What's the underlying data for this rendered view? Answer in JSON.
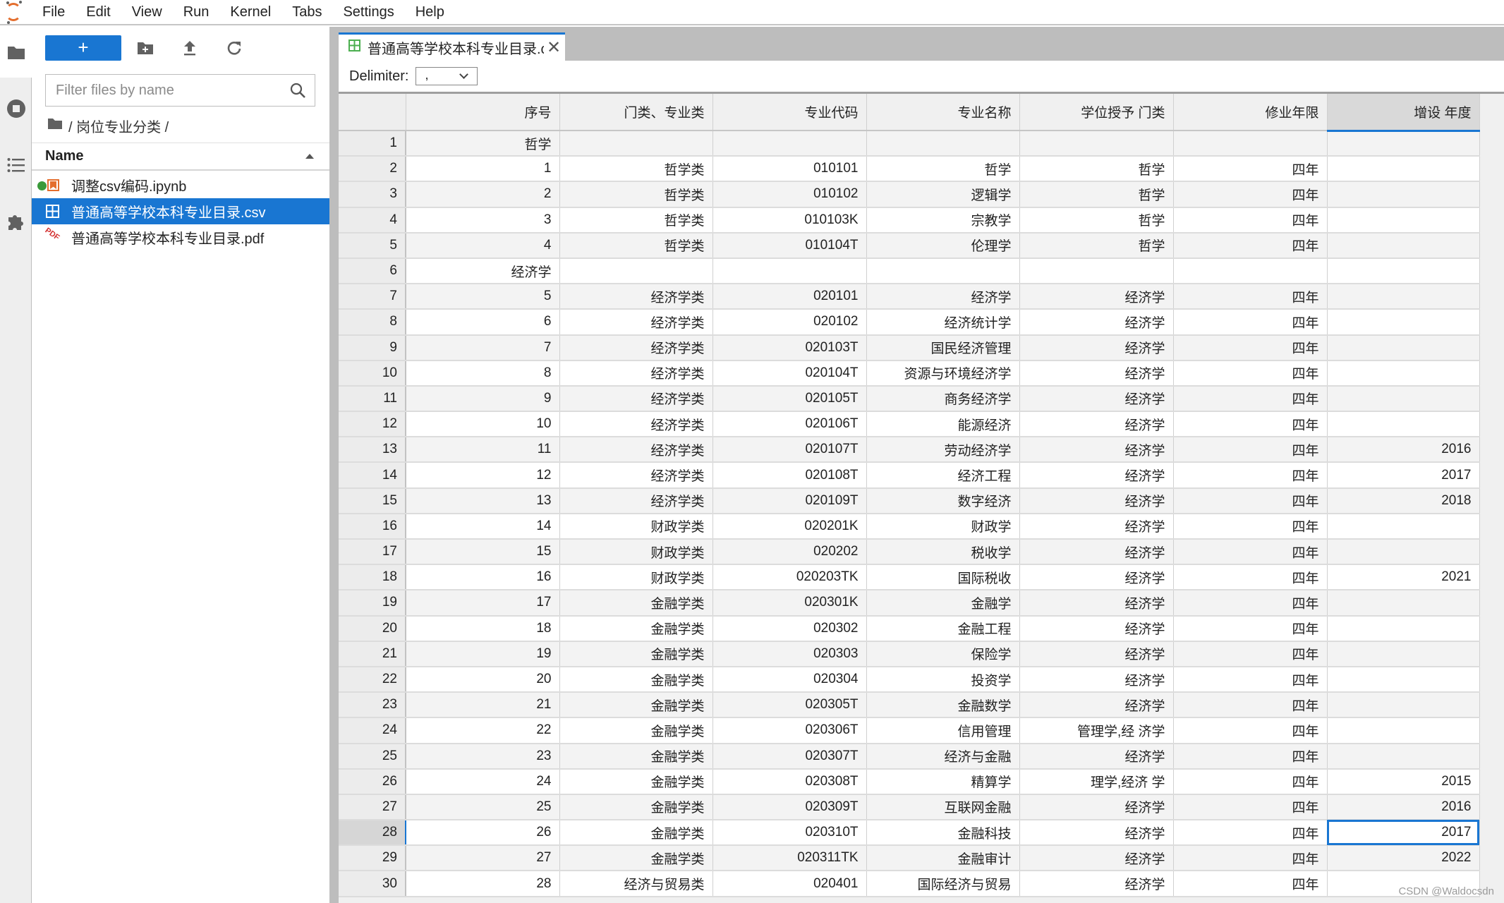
{
  "menubar": {
    "items": [
      "File",
      "Edit",
      "View",
      "Run",
      "Kernel",
      "Tabs",
      "Settings",
      "Help"
    ]
  },
  "left_strip": {
    "icons": [
      "folder-icon",
      "running-stop-icon",
      "table-of-contents-icon",
      "extension-puzzle-icon"
    ]
  },
  "file_browser": {
    "new_button_label": "+",
    "filter_placeholder": "Filter files by name",
    "filter_value": "",
    "breadcrumb": "/ 岗位专业分类 /",
    "column_header": "Name",
    "files": [
      {
        "name": "调整csv编码.ipynb",
        "type": "notebook",
        "running": true,
        "selected": false
      },
      {
        "name": "普通高等学校本科专业目录.csv",
        "type": "csv",
        "running": false,
        "selected": true
      },
      {
        "name": "普通高等学校本科专业目录.pdf",
        "type": "pdf",
        "running": false,
        "selected": false
      }
    ]
  },
  "main": {
    "tab_label": "普通高等学校本科专业目录.csv",
    "delimiter_label": "Delimiter:",
    "delimiter_value": ",",
    "grid": {
      "columns": [
        "序号",
        "门类、专业类",
        "专业代码",
        "专业名称",
        "学位授予 门类",
        "修业年限",
        "增设 年度"
      ],
      "selected_column": 6,
      "selected_row": 28,
      "rows": [
        [
          "哲学",
          "",
          "",
          "",
          "",
          "",
          ""
        ],
        [
          "1",
          "哲学类",
          "010101",
          "哲学",
          "哲学",
          "四年",
          ""
        ],
        [
          "2",
          "哲学类",
          "010102",
          "逻辑学",
          "哲学",
          "四年",
          ""
        ],
        [
          "3",
          "哲学类",
          "010103K",
          "宗教学",
          "哲学",
          "四年",
          ""
        ],
        [
          "4",
          "哲学类",
          "010104T",
          "伦理学",
          "哲学",
          "四年",
          ""
        ],
        [
          "经济学",
          "",
          "",
          "",
          "",
          "",
          ""
        ],
        [
          "5",
          "经济学类",
          "020101",
          "经济学",
          "经济学",
          "四年",
          ""
        ],
        [
          "6",
          "经济学类",
          "020102",
          "经济统计学",
          "经济学",
          "四年",
          ""
        ],
        [
          "7",
          "经济学类",
          "020103T",
          "国民经济管理",
          "经济学",
          "四年",
          ""
        ],
        [
          "8",
          "经济学类",
          "020104T",
          "资源与环境经济学",
          "经济学",
          "四年",
          ""
        ],
        [
          "9",
          "经济学类",
          "020105T",
          "商务经济学",
          "经济学",
          "四年",
          ""
        ],
        [
          "10",
          "经济学类",
          "020106T",
          "能源经济",
          "经济学",
          "四年",
          ""
        ],
        [
          "11",
          "经济学类",
          "020107T",
          "劳动经济学",
          "经济学",
          "四年",
          "2016"
        ],
        [
          "12",
          "经济学类",
          "020108T",
          "经济工程",
          "经济学",
          "四年",
          "2017"
        ],
        [
          "13",
          "经济学类",
          "020109T",
          "数字经济",
          "经济学",
          "四年",
          "2018"
        ],
        [
          "14",
          "财政学类",
          "020201K",
          "财政学",
          "经济学",
          "四年",
          ""
        ],
        [
          "15",
          "财政学类",
          "020202",
          "税收学",
          "经济学",
          "四年",
          ""
        ],
        [
          "16",
          "财政学类",
          "020203TK",
          "国际税收",
          "经济学",
          "四年",
          "2021"
        ],
        [
          "17",
          "金融学类",
          "020301K",
          "金融学",
          "经济学",
          "四年",
          ""
        ],
        [
          "18",
          "金融学类",
          "020302",
          "金融工程",
          "经济学",
          "四年",
          ""
        ],
        [
          "19",
          "金融学类",
          "020303",
          "保险学",
          "经济学",
          "四年",
          ""
        ],
        [
          "20",
          "金融学类",
          "020304",
          "投资学",
          "经济学",
          "四年",
          ""
        ],
        [
          "21",
          "金融学类",
          "020305T",
          "金融数学",
          "经济学",
          "四年",
          ""
        ],
        [
          "22",
          "金融学类",
          "020306T",
          "信用管理",
          "管理学,经 济学",
          "四年",
          ""
        ],
        [
          "23",
          "金融学类",
          "020307T",
          "经济与金融",
          "经济学",
          "四年",
          ""
        ],
        [
          "24",
          "金融学类",
          "020308T",
          "精算学",
          "理学,经济 学",
          "四年",
          "2015"
        ],
        [
          "25",
          "金融学类",
          "020309T",
          "互联网金融",
          "经济学",
          "四年",
          "2016"
        ],
        [
          "26",
          "金融学类",
          "020310T",
          "金融科技",
          "经济学",
          "四年",
          "2017"
        ],
        [
          "27",
          "金融学类",
          "020311TK",
          "金融审计",
          "经济学",
          "四年",
          "2022"
        ],
        [
          "28",
          "经济与贸易类",
          "020401",
          "国际经济与贸易",
          "经济学",
          "四年",
          ""
        ]
      ]
    }
  },
  "watermark": "CSDN @Waldocsdn",
  "colors": {
    "accent": "#1976d2",
    "jupyter_orange": "#e46e2e",
    "kernel_running": "#3a9a3a",
    "pdf_red": "#d32f2f"
  }
}
